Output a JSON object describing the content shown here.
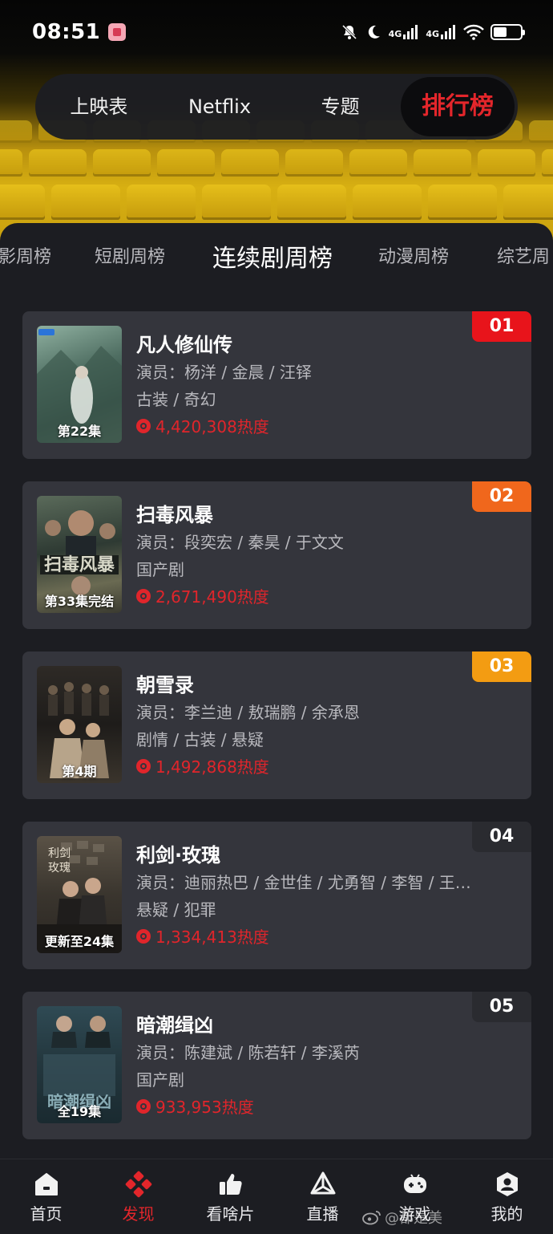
{
  "status_bar": {
    "time": "08:51",
    "network_1": "4G",
    "network_2": "4G"
  },
  "top_nav": {
    "tabs": [
      {
        "label": "上映表"
      },
      {
        "label": "Netflix"
      },
      {
        "label": "专题"
      },
      {
        "label": "排行榜"
      }
    ],
    "active_index": 3
  },
  "sub_tabs": {
    "items": [
      {
        "label": "影周榜"
      },
      {
        "label": "短剧周榜"
      },
      {
        "label": "连续剧周榜"
      },
      {
        "label": "动漫周榜"
      },
      {
        "label": "综艺周"
      }
    ],
    "active_index": 2
  },
  "rankings": [
    {
      "rank": "01",
      "title": "凡人修仙传",
      "cast": "演员：杨洋 / 金晨 / 汪铎",
      "genre": "古装 / 奇幻",
      "heat": "4,420,308热度",
      "poster_label": "第22集",
      "badge_color": "#e8141b"
    },
    {
      "rank": "02",
      "title": "扫毒风暴",
      "cast": "演员：段奕宏 / 秦昊 / 于文文",
      "genre": "国产剧",
      "heat": "2,671,490热度",
      "poster_label": "第33集完结",
      "badge_color": "#f0671c"
    },
    {
      "rank": "03",
      "title": "朝雪录",
      "cast": "演员：李兰迪 / 敖瑞鹏 / 余承恩",
      "genre": "剧情 / 古装 / 悬疑",
      "heat": "1,492,868热度",
      "poster_label": "第4期",
      "badge_color": "#f39c12"
    },
    {
      "rank": "04",
      "title": "利剑·玫瑰",
      "cast": "演员：迪丽热巴 / 金世佳 / 尤勇智 / 李智 / 王…",
      "genre": "悬疑 / 犯罪",
      "heat": "1,334,413热度",
      "poster_label": "更新至24集",
      "badge_color": "#2a2b30"
    },
    {
      "rank": "05",
      "title": "暗潮缉凶",
      "cast": "演员：陈建斌 / 陈若轩 / 李溪芮",
      "genre": "国产剧",
      "heat": "933,953热度",
      "poster_label": "全19集",
      "badge_color": "#2a2b30"
    }
  ],
  "bottom_nav": {
    "items": [
      {
        "label": "首页",
        "icon": "home-icon"
      },
      {
        "label": "发现",
        "icon": "discover-icon"
      },
      {
        "label": "看啥片",
        "icon": "thumbs-up-icon"
      },
      {
        "label": "直播",
        "icon": "live-icon"
      },
      {
        "label": "游戏",
        "icon": "gamepad-icon"
      },
      {
        "label": "我的",
        "icon": "profile-icon"
      }
    ],
    "active_index": 1
  },
  "watermark": "@都是美",
  "colors": {
    "accent_red": "#e3262b",
    "heat_red": "#e0252b",
    "card_bg": "#34353c",
    "page_bg": "#1c1d22"
  }
}
